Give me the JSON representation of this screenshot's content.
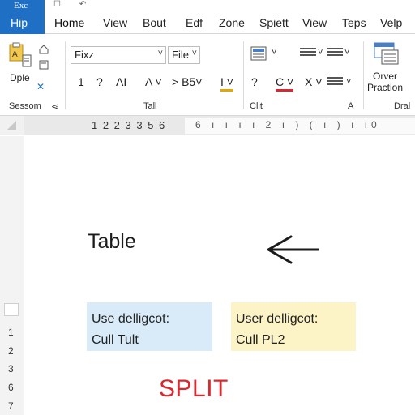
{
  "file_tab": {
    "line1": "Exc",
    "line2": "Hip"
  },
  "quick_access": "☐ ↶",
  "tabs": [
    "Home",
    "View",
    "Bout",
    "Edf",
    "Zone",
    "Spiett",
    "View",
    "Teps",
    "Velp"
  ],
  "ribbon": {
    "clipboard": {
      "paste_label": "Dple",
      "group_label": "Sessom"
    },
    "font": {
      "font_name": "Fixz",
      "font_size": "File",
      "row2": [
        "1",
        "?",
        "AI",
        "A ˅",
        "> B5˅",
        "I ˅",
        "?",
        "C ˅",
        "X ˅"
      ],
      "group_label": "Tall"
    },
    "paragraph": {
      "group_label": "Clit",
      "expander": "A"
    },
    "right": {
      "button_label_1": "Orver",
      "button_label_2": "Praction",
      "group_label": "Dral"
    }
  },
  "ruler": {
    "numbers": "1 2 2 3 3 5 6",
    "marks": "6 ı ı ı ı 2 ı ) ( ı ) ı ı0"
  },
  "vertical_ruler": [
    "1",
    "2",
    "3",
    "6",
    "7"
  ],
  "document": {
    "heading": "Table",
    "card_blue": {
      "line1": "Use delligcot:",
      "line2": "Cull Tult"
    },
    "card_yellow": {
      "line1": "User delligcot:",
      "line2": "Cull PL2"
    },
    "split_label": "SPLIT"
  },
  "colors": {
    "file_tab": "#1f6fc5",
    "card_blue": "#d9ebf9",
    "card_yellow": "#fcf3c6",
    "split_text": "#d9282f"
  }
}
